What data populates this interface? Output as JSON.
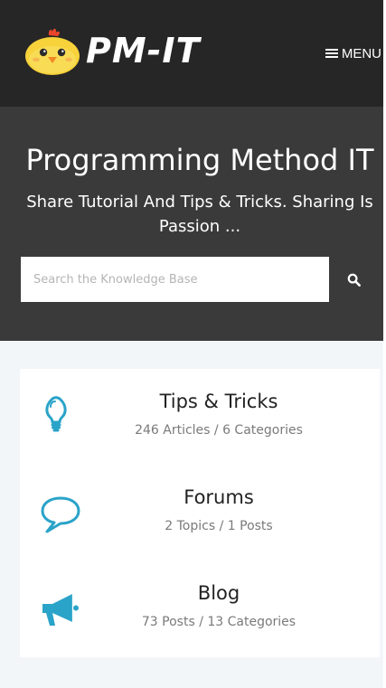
{
  "header": {
    "logo_text": "PM-IT",
    "menu_label": "MENU",
    "icons": [
      "chick-logo-icon",
      "hamburger-icon"
    ]
  },
  "hero": {
    "title": "Programming Method IT",
    "subtitle": "Share Tutorial And Tips & Tricks. Sharing Is Passion ...",
    "search": {
      "placeholder": "Search the Knowledge Base",
      "value": "",
      "button_icon": "search-icon"
    }
  },
  "sections": [
    {
      "title": "Tips & Tricks",
      "meta": "246 Articles / 6 Categories",
      "icon": "lightbulb-icon"
    },
    {
      "title": "Forums",
      "meta": "2 Topics / 1 Posts",
      "icon": "speech-bubble-icon"
    },
    {
      "title": "Blog",
      "meta": "73 Posts / 13 Categories",
      "icon": "megaphone-icon"
    }
  ],
  "colors": {
    "header_bg": "#262626",
    "hero_bg": "#3a3a3a",
    "content_bg": "#f3f6f9",
    "icon_accent": "#2aa3c9",
    "logo_yellow": "#f7d23a"
  }
}
